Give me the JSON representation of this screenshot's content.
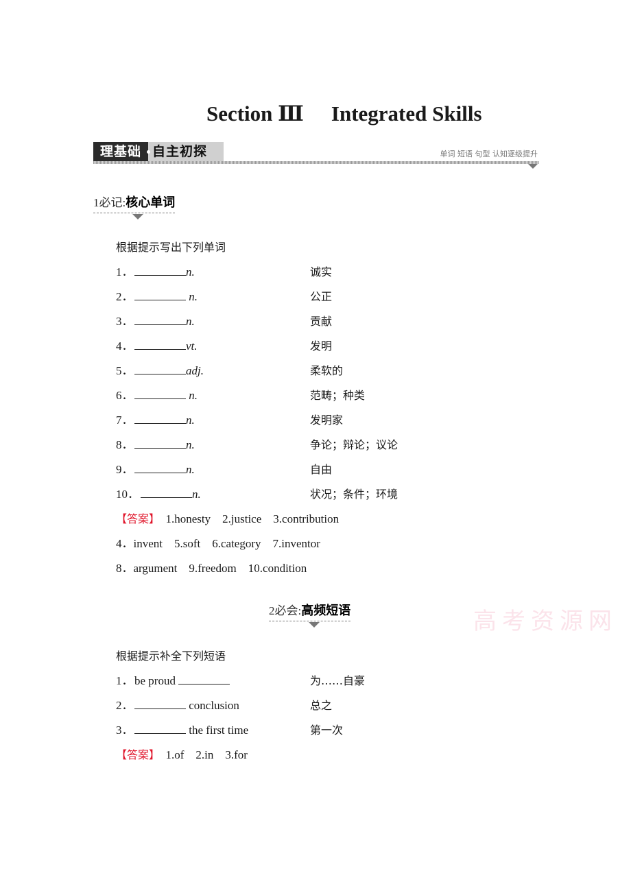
{
  "title": {
    "left": "Section Ⅲ",
    "right": "Integrated Skills"
  },
  "banner": {
    "dark_label": "理基础",
    "light_label": "自主初探",
    "right_text": "单词 短语 句型  认知逐级提升"
  },
  "section1": {
    "num": "1必记:",
    "heading": "核心单词",
    "instruction": "根据提示写出下列单词",
    "items": [
      {
        "num": "1．",
        "pos": "n.",
        "meaning": "诚实"
      },
      {
        "num": "2．",
        "pos": " n.",
        "meaning": "公正"
      },
      {
        "num": "3．",
        "pos": "n.",
        "meaning": "贡献"
      },
      {
        "num": "4．",
        "pos": "vt.",
        "meaning": "发明"
      },
      {
        "num": "5．",
        "pos": "adj.",
        "meaning": "柔软的"
      },
      {
        "num": "6．",
        "pos": " n.",
        "meaning": "范畴；种类"
      },
      {
        "num": "7．",
        "pos": "n.",
        "meaning": "发明家"
      },
      {
        "num": "8．",
        "pos": "n.",
        "meaning": "争论；辩论；议论"
      },
      {
        "num": "9．",
        "pos": "n.",
        "meaning": "自由"
      },
      {
        "num": "10．",
        "pos": "n.",
        "meaning": "状况；条件；环境"
      }
    ],
    "answer_label": "【答案】",
    "answers": [
      "1.honesty    2.justice    3.contribution",
      "4．invent    5.soft    6.category    7.inventor",
      "8．argument    9.freedom    10.condition"
    ]
  },
  "section2": {
    "num": "2必会:",
    "heading": "高频短语",
    "instruction": "根据提示补全下列短语",
    "items": [
      {
        "num": "1．",
        "before": "be proud ",
        "after": "",
        "meaning": "为……自豪"
      },
      {
        "num": "2．",
        "before": "",
        "after": " conclusion",
        "meaning": "总之"
      },
      {
        "num": "3．",
        "before": "",
        "after": " the first time",
        "meaning": "第一次"
      }
    ],
    "answer_label": "【答案】",
    "answers": "1.of    2.in    3.for"
  },
  "watermark": "高考资源网"
}
